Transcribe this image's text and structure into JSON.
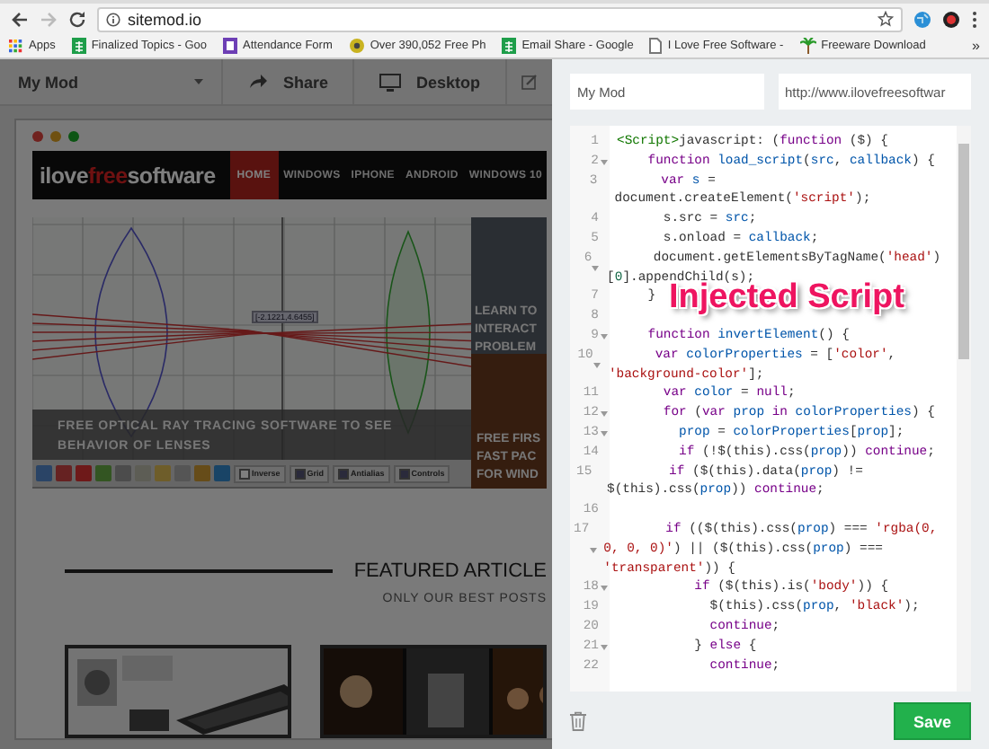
{
  "browser": {
    "url": "sitemod.io",
    "more": "»",
    "bookmarks": [
      {
        "label": "Apps",
        "kind": "apps"
      },
      {
        "label": "Finalized Topics - Goo",
        "kind": "sheet"
      },
      {
        "label": "Attendance Form",
        "kind": "form"
      },
      {
        "label": "Over 390,052 Free Ph",
        "kind": "site"
      },
      {
        "label": "Email Share - Google",
        "kind": "sheet"
      },
      {
        "label": "I Love Free Software -",
        "kind": "page"
      },
      {
        "label": "Freeware Download",
        "kind": "palm"
      }
    ]
  },
  "toolbar": {
    "mod": "My Mod",
    "actions": [
      {
        "label": "Share",
        "kind": "share"
      },
      {
        "label": "Desktop",
        "kind": "desktop"
      }
    ]
  },
  "preview": {
    "logo": {
      "start": "ilove",
      "accent": "free",
      "end": "software"
    },
    "nav": [
      {
        "label": "HOME",
        "selected": true
      },
      {
        "label": "WINDOWS",
        "selected": false
      },
      {
        "label": "IPHONE",
        "selected": false
      },
      {
        "label": "ANDROID",
        "selected": false
      },
      {
        "label": "WINDOWS 10",
        "selected": false
      }
    ],
    "feature": {
      "caption": "FREE OPTICAL RAY TRACING SOFTWARE TO SEE BEHAVIOR OF LENSES",
      "coordinate": "[-2.1221,4.6455]",
      "options": [
        {
          "label": "Inverse",
          "checked": false
        },
        {
          "label": "Grid",
          "checked": true
        },
        {
          "label": "Antialias",
          "checked": true
        },
        {
          "label": "Controls",
          "checked": true
        }
      ]
    },
    "side_posts": [
      {
        "lines": [
          "LEARN TO",
          "INTERACT",
          "PROBLEM"
        ],
        "kind": "code"
      },
      {
        "lines": [
          "FREE FIRS",
          "FAST PAC",
          "FOR WIND"
        ]
      }
    ],
    "featured": {
      "title": "FEATURED ARTICLE",
      "subtitle": "ONLY OUR BEST POSTS"
    }
  },
  "editor": {
    "name": "My Mod",
    "url": "http://www.ilovefreesoftwar",
    "annotation": "Injected Script",
    "save": "Save",
    "lines": [
      {
        "number": "1",
        "foldable": false,
        "segments": [
          {
            "kind": "tag",
            "text": "<Script>"
          },
          {
            "kind": "plain",
            "text": "javascript: ("
          },
          {
            "kind": "kw",
            "text": "function"
          },
          {
            "kind": "plain",
            "text": " ($) {"
          }
        ]
      },
      {
        "number": "2",
        "foldable": true,
        "segments": [
          {
            "kind": "kw",
            "text": "    function"
          },
          {
            "kind": "name",
            "text": " load_script"
          },
          {
            "kind": "plain",
            "text": "("
          },
          {
            "kind": "name",
            "text": "src"
          },
          {
            "kind": "plain",
            "text": ", "
          },
          {
            "kind": "name",
            "text": "callback"
          },
          {
            "kind": "plain",
            "text": ") {"
          }
        ]
      },
      {
        "number": "3",
        "foldable": false,
        "segments": [
          {
            "kind": "kw",
            "text": "      var"
          },
          {
            "kind": "name",
            "text": " s"
          },
          {
            "kind": "plain",
            "text": " = document.createElement("
          },
          {
            "kind": "str",
            "text": "'script'"
          },
          {
            "kind": "plain",
            "text": ");"
          }
        ]
      },
      {
        "number": "4",
        "foldable": false,
        "segments": [
          {
            "kind": "plain",
            "text": "      s.src = "
          },
          {
            "kind": "name",
            "text": "src"
          },
          {
            "kind": "plain",
            "text": ";"
          }
        ]
      },
      {
        "number": "5",
        "foldable": false,
        "segments": [
          {
            "kind": "plain",
            "text": "      s.onload = "
          },
          {
            "kind": "name",
            "text": "callback"
          },
          {
            "kind": "plain",
            "text": ";"
          }
        ]
      },
      {
        "number": "6",
        "foldable": true,
        "segments": [
          {
            "kind": "plain",
            "text": "      document.getElementsByTagName("
          },
          {
            "kind": "str",
            "text": "'head'"
          },
          {
            "kind": "plain",
            "text": ")["
          },
          {
            "kind": "num",
            "text": "0"
          },
          {
            "kind": "plain",
            "text": "].appendChild(s);"
          }
        ]
      },
      {
        "number": "7",
        "foldable": false,
        "segments": [
          {
            "kind": "plain",
            "text": "    }"
          }
        ]
      },
      {
        "number": "8",
        "foldable": false
      },
      {
        "number": "9",
        "foldable": true,
        "segments": [
          {
            "kind": "kw",
            "text": "    function"
          },
          {
            "kind": "name",
            "text": " invertElement"
          },
          {
            "kind": "plain",
            "text": "() {"
          }
        ]
      },
      {
        "number": "10",
        "foldable": true,
        "segments": [
          {
            "kind": "kw",
            "text": "      var"
          },
          {
            "kind": "name",
            "text": " colorProperties"
          },
          {
            "kind": "plain",
            "text": " = ["
          },
          {
            "kind": "str",
            "text": "'color'"
          },
          {
            "kind": "plain",
            "text": ", "
          },
          {
            "kind": "str",
            "text": "'background-color'"
          },
          {
            "kind": "plain",
            "text": "];"
          }
        ]
      },
      {
        "number": "11",
        "foldable": false,
        "segments": [
          {
            "kind": "kw",
            "text": "      var"
          },
          {
            "kind": "name",
            "text": " color"
          },
          {
            "kind": "plain",
            "text": " = "
          },
          {
            "kind": "kw",
            "text": "null"
          },
          {
            "kind": "plain",
            "text": ";"
          }
        ]
      },
      {
        "number": "12",
        "foldable": true,
        "segments": [
          {
            "kind": "kw",
            "text": "      for"
          },
          {
            "kind": "plain",
            "text": " ("
          },
          {
            "kind": "kw",
            "text": "var"
          },
          {
            "kind": "name",
            "text": " prop"
          },
          {
            "kind": "kw",
            "text": " in"
          },
          {
            "kind": "name",
            "text": " colorProperties"
          },
          {
            "kind": "plain",
            "text": ") {"
          }
        ]
      },
      {
        "number": "13",
        "foldable": true,
        "segments": [
          {
            "kind": "name",
            "text": "        prop"
          },
          {
            "kind": "plain",
            "text": " = "
          },
          {
            "kind": "name",
            "text": "colorProperties"
          },
          {
            "kind": "plain",
            "text": "["
          },
          {
            "kind": "name",
            "text": "prop"
          },
          {
            "kind": "plain",
            "text": "];"
          }
        ]
      },
      {
        "number": "14",
        "foldable": false,
        "segments": [
          {
            "kind": "kw",
            "text": "        if"
          },
          {
            "kind": "plain",
            "text": " (!$(this).css("
          },
          {
            "kind": "name",
            "text": "prop"
          },
          {
            "kind": "plain",
            "text": ")) "
          },
          {
            "kind": "kw",
            "text": "continue"
          },
          {
            "kind": "plain",
            "text": ";"
          }
        ]
      },
      {
        "number": "15",
        "foldable": false,
        "segments": [
          {
            "kind": "kw",
            "text": "        if"
          },
          {
            "kind": "plain",
            "text": " ($(this).data("
          },
          {
            "kind": "name",
            "text": "prop"
          },
          {
            "kind": "plain",
            "text": ") != $(this).css("
          },
          {
            "kind": "name",
            "text": "prop"
          },
          {
            "kind": "plain",
            "text": ")) "
          },
          {
            "kind": "kw",
            "text": "continue"
          },
          {
            "kind": "plain",
            "text": ";"
          }
        ]
      },
      {
        "number": "16",
        "foldable": false
      },
      {
        "number": "17",
        "foldable": true,
        "segments": [
          {
            "kind": "kw",
            "text": "        if"
          },
          {
            "kind": "plain",
            "text": " (($(this).css("
          },
          {
            "kind": "name",
            "text": "prop"
          },
          {
            "kind": "plain",
            "text": ") === "
          },
          {
            "kind": "str",
            "text": "'rgba(0, 0, 0, 0)'"
          },
          {
            "kind": "plain",
            "text": ") || ($(this).css("
          },
          {
            "kind": "name",
            "text": "prop"
          },
          {
            "kind": "plain",
            "text": ") === "
          },
          {
            "kind": "str",
            "text": "'transparent'"
          },
          {
            "kind": "plain",
            "text": ")) {"
          }
        ]
      },
      {
        "number": "18",
        "foldable": true,
        "segments": [
          {
            "kind": "kw",
            "text": "          if"
          },
          {
            "kind": "plain",
            "text": " ($(this).is("
          },
          {
            "kind": "str",
            "text": "'body'"
          },
          {
            "kind": "plain",
            "text": ")) {"
          }
        ]
      },
      {
        "number": "19",
        "foldable": false,
        "segments": [
          {
            "kind": "plain",
            "text": "            $(this).css("
          },
          {
            "kind": "name",
            "text": "prop"
          },
          {
            "kind": "plain",
            "text": ", "
          },
          {
            "kind": "str",
            "text": "'black'"
          },
          {
            "kind": "plain",
            "text": ");"
          }
        ]
      },
      {
        "number": "20",
        "foldable": false,
        "segments": [
          {
            "kind": "kw",
            "text": "            continue"
          },
          {
            "kind": "plain",
            "text": ";"
          }
        ]
      },
      {
        "number": "21",
        "foldable": true,
        "segments": [
          {
            "kind": "plain",
            "text": "          } "
          },
          {
            "kind": "kw",
            "text": "else"
          },
          {
            "kind": "plain",
            "text": " {"
          }
        ]
      },
      {
        "number": "22",
        "foldable": false,
        "segments": [
          {
            "kind": "kw",
            "text": "            continue"
          },
          {
            "kind": "plain",
            "text": ";"
          }
        ]
      }
    ]
  }
}
